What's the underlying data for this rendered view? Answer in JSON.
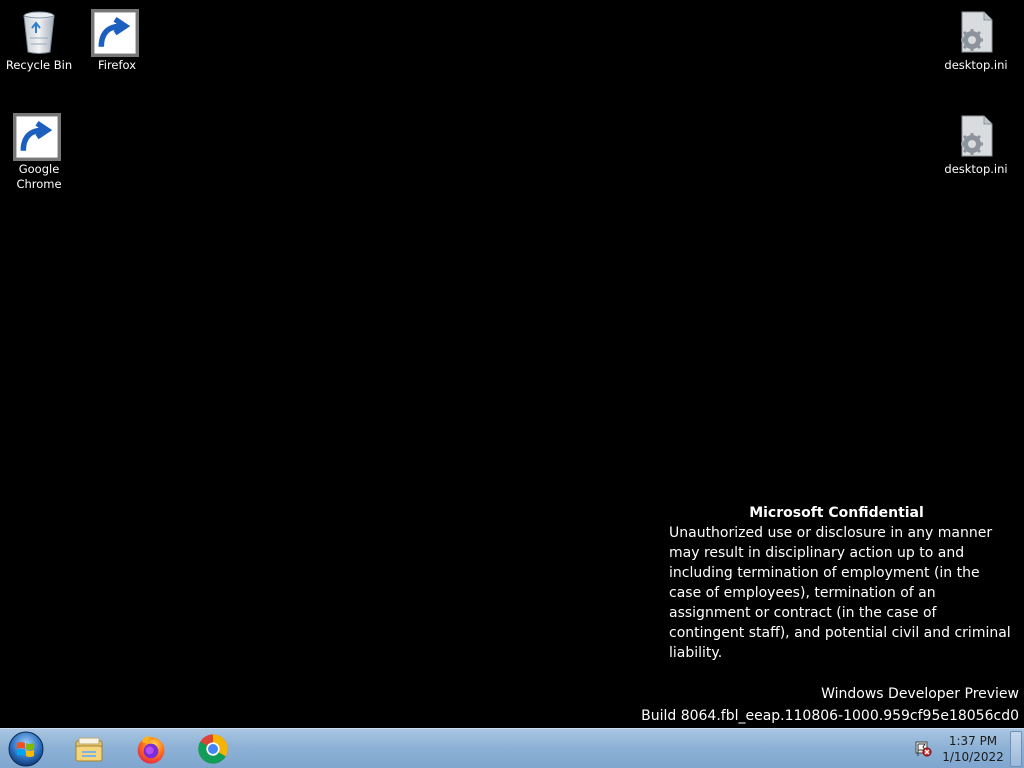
{
  "desktop": {
    "icons": [
      {
        "label": "Recycle Bin",
        "icon": "recycle-bin-icon"
      },
      {
        "label": "Firefox",
        "icon": "firefox-icon"
      },
      {
        "label": "Google Chrome",
        "icon": "chrome-icon"
      },
      {
        "label": "desktop.ini",
        "icon": "settings-file-icon"
      },
      {
        "label": "desktop.ini",
        "icon": "settings-file-icon"
      }
    ]
  },
  "notice": {
    "title": "Microsoft Confidential",
    "body": "Unauthorized use or disclosure in any manner may result in disciplinary action up to and including termination of employment (in the case of employees), termination of an assignment or contract (in the case of contingent staff), and potential civil and criminal liability."
  },
  "watermark": {
    "line1": "Windows Developer Preview",
    "line2": "Build 8064.fbl_eeap.110806-1000.959cf95e18056cd0"
  },
  "taskbar": {
    "start": "windows-start-orb-icon",
    "pinned": [
      "file-explorer-icon",
      "firefox-icon",
      "chrome-icon"
    ],
    "tray_icon": "action-center-flag-icon",
    "clock": {
      "time": "1:37 PM",
      "date": "1/10/2022"
    }
  },
  "colors": {
    "wallpaper": "#000000",
    "taskbar": "#8eb2d6",
    "text": "#ffffff"
  }
}
